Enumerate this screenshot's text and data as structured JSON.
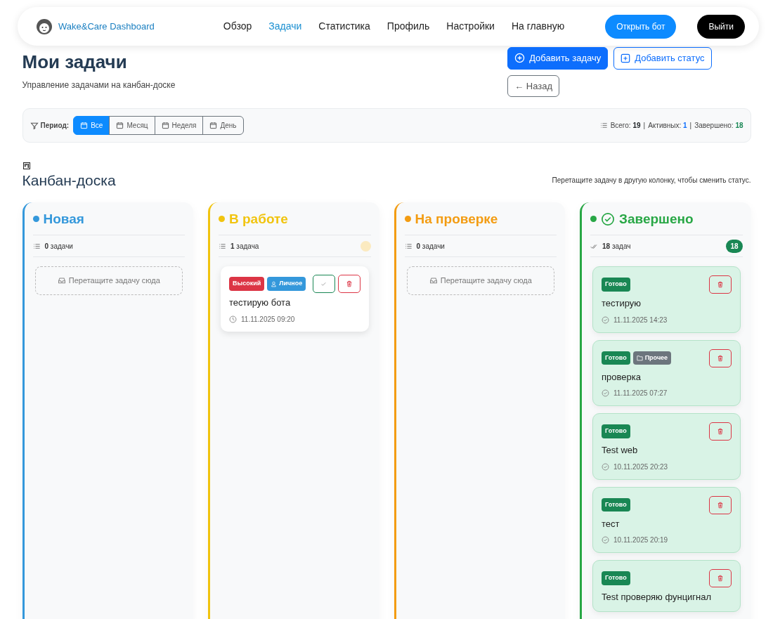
{
  "navbar": {
    "brand": "Wake&Care Dashboard",
    "links": [
      {
        "label": "Обзор",
        "selected": false
      },
      {
        "label": "Задачи",
        "selected": true
      },
      {
        "label": "Статистика",
        "selected": false
      },
      {
        "label": "Профиль",
        "selected": false
      },
      {
        "label": "Настройки",
        "selected": false
      },
      {
        "label": "На главную",
        "selected": false
      }
    ],
    "open_bot": "Открыть бот",
    "logout": "Выйти"
  },
  "header": {
    "title": "Мои задачи",
    "subtitle": "Управление задачами на канбан-доске",
    "add_task": "Добавить задачу",
    "add_status": "Добавить статус",
    "back": "← Назад"
  },
  "filter": {
    "label": "Период:",
    "periods": [
      {
        "label": "Все",
        "selected": true
      },
      {
        "label": "Месяц",
        "selected": false
      },
      {
        "label": "Неделя",
        "selected": false
      },
      {
        "label": "День",
        "selected": false
      }
    ],
    "separator": "|",
    "stats": [
      {
        "label": "Всего:",
        "value": "19",
        "color": "#212529"
      },
      {
        "label": "Активных:",
        "value": "1",
        "color": "#0d6efd"
      },
      {
        "label": "Завершено:",
        "value": "18",
        "color": "#198754"
      }
    ]
  },
  "board": {
    "title": "Канбан-доска",
    "hint": "Перетащите задачу в другую колонку, чтобы сменить статус.",
    "columns": [
      {
        "title": "Новая",
        "kind": "todo",
        "color": "#3498db",
        "count": "0",
        "count_label": "задачи",
        "empty": "Перетащите задачу сюда"
      },
      {
        "title": "В работе",
        "kind": "progress",
        "color": "#f1c40f",
        "count": "1",
        "count_label": "задача",
        "cards": [
          {
            "done": false,
            "tags": [
              {
                "label": "Высокий",
                "kind": "priority"
              },
              {
                "label": "Личное",
                "kind": "personal"
              }
            ],
            "title": "тестирую бота",
            "date": "11.11.2025 09:20"
          }
        ]
      },
      {
        "title": "На проверке",
        "kind": "review",
        "color": "#f39c12",
        "count": "0",
        "count_label": "задачи",
        "empty": "Перетащите задачу сюда"
      },
      {
        "title": "Завершено",
        "kind": "done",
        "color": "#28a745",
        "count": "18",
        "count_label": "задач",
        "badge": "18",
        "cards": [
          {
            "done": true,
            "tags": [
              {
                "label": "Готово",
                "kind": "done"
              }
            ],
            "title": "тестирую",
            "date": "11.11.2025 14:23"
          },
          {
            "done": true,
            "tags": [
              {
                "label": "Готово",
                "kind": "done"
              },
              {
                "label": "Прочее",
                "kind": "other"
              }
            ],
            "title": "проверка",
            "date": "11.11.2025 07:27"
          },
          {
            "done": true,
            "tags": [
              {
                "label": "Готово",
                "kind": "done"
              }
            ],
            "title": "Test web",
            "date": "10.11.2025 20:23"
          },
          {
            "done": true,
            "tags": [
              {
                "label": "Готово",
                "kind": "done"
              }
            ],
            "title": "тест",
            "date": "10.11.2025 20:19"
          },
          {
            "done": true,
            "tags": [
              {
                "label": "Готово",
                "kind": "done"
              }
            ],
            "title": "Test проверяю фунцигнал"
          }
        ]
      }
    ]
  }
}
